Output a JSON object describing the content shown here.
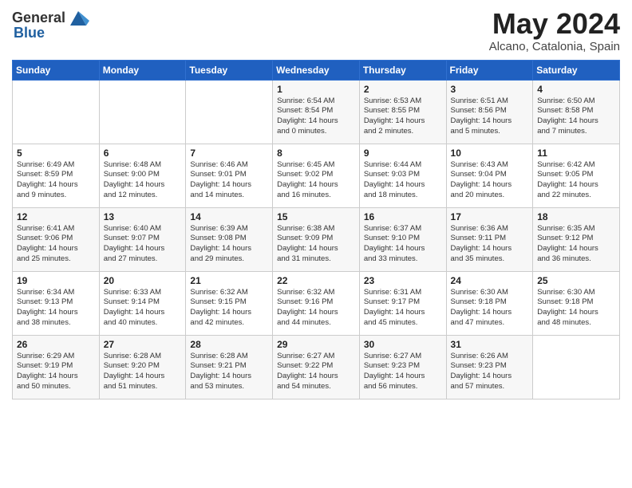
{
  "header": {
    "logo_general": "General",
    "logo_blue": "Blue",
    "month": "May 2024",
    "location": "Alcano, Catalonia, Spain"
  },
  "weekdays": [
    "Sunday",
    "Monday",
    "Tuesday",
    "Wednesday",
    "Thursday",
    "Friday",
    "Saturday"
  ],
  "weeks": [
    [
      {
        "day": "",
        "content": ""
      },
      {
        "day": "",
        "content": ""
      },
      {
        "day": "",
        "content": ""
      },
      {
        "day": "1",
        "content": "Sunrise: 6:54 AM\nSunset: 8:54 PM\nDaylight: 14 hours\nand 0 minutes."
      },
      {
        "day": "2",
        "content": "Sunrise: 6:53 AM\nSunset: 8:55 PM\nDaylight: 14 hours\nand 2 minutes."
      },
      {
        "day": "3",
        "content": "Sunrise: 6:51 AM\nSunset: 8:56 PM\nDaylight: 14 hours\nand 5 minutes."
      },
      {
        "day": "4",
        "content": "Sunrise: 6:50 AM\nSunset: 8:58 PM\nDaylight: 14 hours\nand 7 minutes."
      }
    ],
    [
      {
        "day": "5",
        "content": "Sunrise: 6:49 AM\nSunset: 8:59 PM\nDaylight: 14 hours\nand 9 minutes."
      },
      {
        "day": "6",
        "content": "Sunrise: 6:48 AM\nSunset: 9:00 PM\nDaylight: 14 hours\nand 12 minutes."
      },
      {
        "day": "7",
        "content": "Sunrise: 6:46 AM\nSunset: 9:01 PM\nDaylight: 14 hours\nand 14 minutes."
      },
      {
        "day": "8",
        "content": "Sunrise: 6:45 AM\nSunset: 9:02 PM\nDaylight: 14 hours\nand 16 minutes."
      },
      {
        "day": "9",
        "content": "Sunrise: 6:44 AM\nSunset: 9:03 PM\nDaylight: 14 hours\nand 18 minutes."
      },
      {
        "day": "10",
        "content": "Sunrise: 6:43 AM\nSunset: 9:04 PM\nDaylight: 14 hours\nand 20 minutes."
      },
      {
        "day": "11",
        "content": "Sunrise: 6:42 AM\nSunset: 9:05 PM\nDaylight: 14 hours\nand 22 minutes."
      }
    ],
    [
      {
        "day": "12",
        "content": "Sunrise: 6:41 AM\nSunset: 9:06 PM\nDaylight: 14 hours\nand 25 minutes."
      },
      {
        "day": "13",
        "content": "Sunrise: 6:40 AM\nSunset: 9:07 PM\nDaylight: 14 hours\nand 27 minutes."
      },
      {
        "day": "14",
        "content": "Sunrise: 6:39 AM\nSunset: 9:08 PM\nDaylight: 14 hours\nand 29 minutes."
      },
      {
        "day": "15",
        "content": "Sunrise: 6:38 AM\nSunset: 9:09 PM\nDaylight: 14 hours\nand 31 minutes."
      },
      {
        "day": "16",
        "content": "Sunrise: 6:37 AM\nSunset: 9:10 PM\nDaylight: 14 hours\nand 33 minutes."
      },
      {
        "day": "17",
        "content": "Sunrise: 6:36 AM\nSunset: 9:11 PM\nDaylight: 14 hours\nand 35 minutes."
      },
      {
        "day": "18",
        "content": "Sunrise: 6:35 AM\nSunset: 9:12 PM\nDaylight: 14 hours\nand 36 minutes."
      }
    ],
    [
      {
        "day": "19",
        "content": "Sunrise: 6:34 AM\nSunset: 9:13 PM\nDaylight: 14 hours\nand 38 minutes."
      },
      {
        "day": "20",
        "content": "Sunrise: 6:33 AM\nSunset: 9:14 PM\nDaylight: 14 hours\nand 40 minutes."
      },
      {
        "day": "21",
        "content": "Sunrise: 6:32 AM\nSunset: 9:15 PM\nDaylight: 14 hours\nand 42 minutes."
      },
      {
        "day": "22",
        "content": "Sunrise: 6:32 AM\nSunset: 9:16 PM\nDaylight: 14 hours\nand 44 minutes."
      },
      {
        "day": "23",
        "content": "Sunrise: 6:31 AM\nSunset: 9:17 PM\nDaylight: 14 hours\nand 45 minutes."
      },
      {
        "day": "24",
        "content": "Sunrise: 6:30 AM\nSunset: 9:18 PM\nDaylight: 14 hours\nand 47 minutes."
      },
      {
        "day": "25",
        "content": "Sunrise: 6:30 AM\nSunset: 9:18 PM\nDaylight: 14 hours\nand 48 minutes."
      }
    ],
    [
      {
        "day": "26",
        "content": "Sunrise: 6:29 AM\nSunset: 9:19 PM\nDaylight: 14 hours\nand 50 minutes."
      },
      {
        "day": "27",
        "content": "Sunrise: 6:28 AM\nSunset: 9:20 PM\nDaylight: 14 hours\nand 51 minutes."
      },
      {
        "day": "28",
        "content": "Sunrise: 6:28 AM\nSunset: 9:21 PM\nDaylight: 14 hours\nand 53 minutes."
      },
      {
        "day": "29",
        "content": "Sunrise: 6:27 AM\nSunset: 9:22 PM\nDaylight: 14 hours\nand 54 minutes."
      },
      {
        "day": "30",
        "content": "Sunrise: 6:27 AM\nSunset: 9:23 PM\nDaylight: 14 hours\nand 56 minutes."
      },
      {
        "day": "31",
        "content": "Sunrise: 6:26 AM\nSunset: 9:23 PM\nDaylight: 14 hours\nand 57 minutes."
      },
      {
        "day": "",
        "content": ""
      }
    ]
  ]
}
